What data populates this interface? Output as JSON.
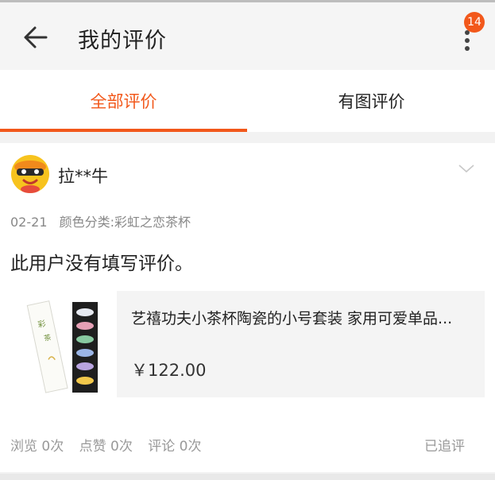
{
  "header": {
    "title": "我的评价",
    "badge_count": "14"
  },
  "tabs": [
    {
      "label": "全部评价",
      "active": true
    },
    {
      "label": "有图评价",
      "active": false
    }
  ],
  "review": {
    "username": "拉**牛",
    "date": "02-21",
    "spec": "颜色分类:彩虹之恋茶杯",
    "content": "此用户没有填写评价。",
    "product": {
      "title": "艺禧功夫小茶杯陶瓷的小号套装 家用可爱单品...",
      "price": "￥122.00"
    },
    "stats": {
      "views": "浏览 0次",
      "likes": "点赞 0次",
      "comments": "评论 0次"
    },
    "followup_label": "已追评"
  },
  "colors": {
    "accent": "#f2581b"
  },
  "icons": {
    "back": "back-arrow-icon",
    "more": "more-vertical-icon",
    "expand": "chevron-down-icon"
  }
}
